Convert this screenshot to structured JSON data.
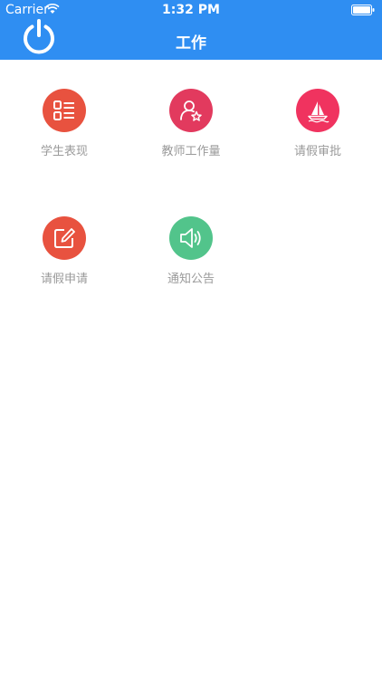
{
  "status_bar": {
    "carrier": "Carrier",
    "time": "1:32 PM"
  },
  "header": {
    "title": "工作",
    "power_icon": "power-icon",
    "color": "#2f8ef2"
  },
  "menu": [
    {
      "label": "学生表现",
      "icon": "list-icon",
      "color": "#e8523f"
    },
    {
      "label": "教师工作量",
      "icon": "user-star-icon",
      "color": "#e23a5e"
    },
    {
      "label": "请假审批",
      "icon": "sailboat-icon",
      "color": "#f0335f"
    },
    {
      "label": "请假申请",
      "icon": "edit-icon",
      "color": "#e8523f"
    },
    {
      "label": "通知公告",
      "icon": "speaker-icon",
      "color": "#52c48b"
    }
  ]
}
